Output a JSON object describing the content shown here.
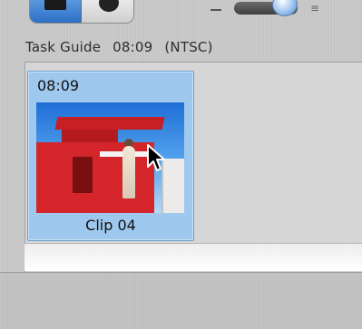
{
  "header": {
    "toolbar_right_glyph": "≡"
  },
  "task_guide": {
    "label": "Task Guide",
    "duration": "08:09",
    "format": "(NTSC)"
  },
  "clip": {
    "duration": "08:09",
    "name": "Clip 04"
  },
  "colors": {
    "selection_blue": "#9ec8ee",
    "caboose_red": "#d4262a"
  },
  "icons": {
    "toolbar_left": "film-icon",
    "toolbar_right": "camera-icon",
    "cursor": "arrow-cursor-icon",
    "slider": "zoom-slider-knob"
  }
}
